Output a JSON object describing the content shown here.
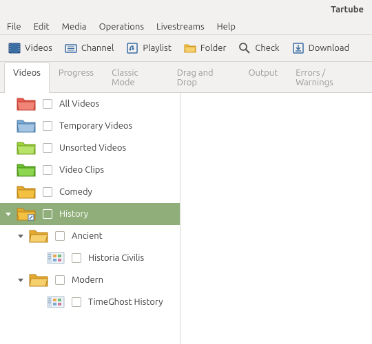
{
  "window": {
    "title": "Tartube"
  },
  "menu": {
    "items": [
      "File",
      "Edit",
      "Media",
      "Operations",
      "Livestreams",
      "Help"
    ]
  },
  "toolbar": {
    "videos": "Videos",
    "channel": "Channel",
    "playlist": "Playlist",
    "folder": "Folder",
    "check": "Check",
    "download": "Download"
  },
  "tabs": {
    "videos": "Videos",
    "progress": "Progress",
    "classic": "Classic Mode",
    "drag": "Drag and Drop",
    "output": "Output",
    "errors": "Errors / Warnings"
  },
  "tree": {
    "all_videos": "All Videos",
    "temporary": "Temporary Videos",
    "unsorted": "Unsorted Videos",
    "clips": "Video Clips",
    "comedy": "Comedy",
    "history": "History",
    "ancient": "Ancient",
    "historia": "Historia Civilis",
    "modern": "Modern",
    "timeghost": "TimeGhost History"
  },
  "colors": {
    "red": "#e85d4f",
    "blue": "#7aa9d4",
    "green_light": "#9dd43a",
    "green": "#6bbf2e",
    "yellow": "#f3c041",
    "yellow_dark": "#e3a82e"
  }
}
